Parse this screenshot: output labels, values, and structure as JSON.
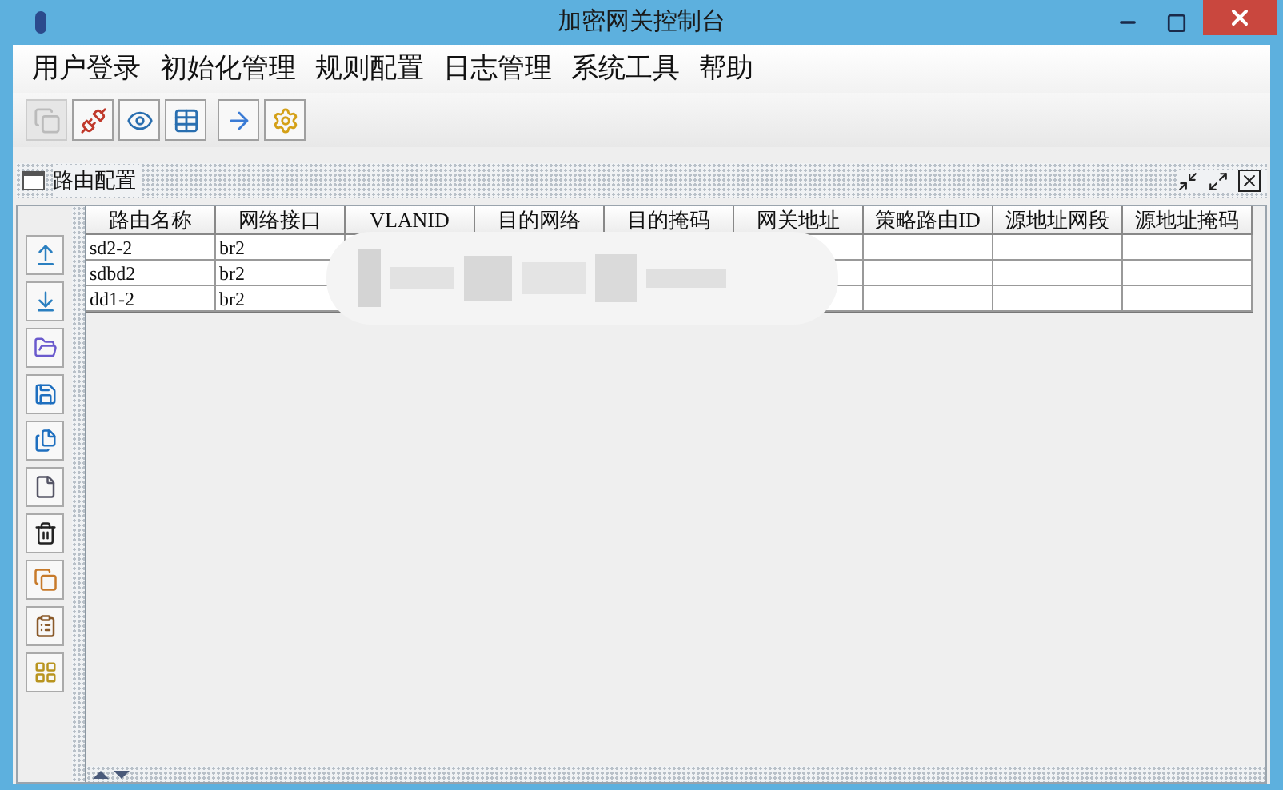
{
  "window": {
    "title": "加密网关控制台"
  },
  "menu": [
    "用户登录",
    "初始化管理",
    "规则配置",
    "日志管理",
    "系统工具",
    "帮助"
  ],
  "toolbar": [
    {
      "kind": "windows",
      "disabled": true
    },
    {
      "kind": "disconnect",
      "disabled": false
    },
    {
      "kind": "view",
      "disabled": false
    },
    {
      "kind": "form",
      "disabled": false
    },
    {
      "kind": "forward",
      "disabled": false
    },
    {
      "kind": "settings",
      "disabled": false
    }
  ],
  "frame": {
    "title": "路由配置"
  },
  "side_tools": [
    {
      "kind": "up"
    },
    {
      "kind": "down"
    },
    {
      "kind": "open"
    },
    {
      "kind": "save"
    },
    {
      "kind": "saveall"
    },
    {
      "kind": "new"
    },
    {
      "kind": "delete"
    },
    {
      "kind": "copy"
    },
    {
      "kind": "paste"
    },
    {
      "kind": "grid"
    }
  ],
  "table": {
    "columns": [
      "路由名称",
      "网络接口",
      "VLANID",
      "目的网络",
      "目的掩码",
      "网关地址",
      "策略路由ID",
      "源地址网段",
      "源地址掩码"
    ],
    "rows": [
      [
        "sd2-2",
        "br2"
      ],
      [
        "sdbd2",
        "br2"
      ],
      [
        "dd1-2",
        "br2"
      ]
    ]
  }
}
